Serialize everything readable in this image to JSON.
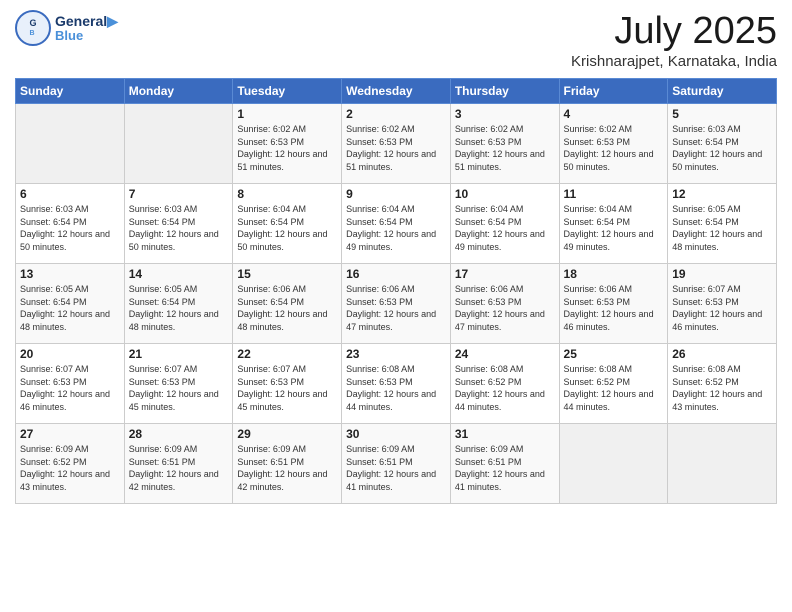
{
  "logo": {
    "line1": "General",
    "line2": "Blue"
  },
  "title": "July 2025",
  "subtitle": "Krishnarajpet, Karnataka, India",
  "days_of_week": [
    "Sunday",
    "Monday",
    "Tuesday",
    "Wednesday",
    "Thursday",
    "Friday",
    "Saturday"
  ],
  "weeks": [
    [
      {
        "day": "",
        "empty": true
      },
      {
        "day": "",
        "empty": true
      },
      {
        "day": "1",
        "sunrise": "6:02 AM",
        "sunset": "6:53 PM",
        "daylight": "12 hours and 51 minutes."
      },
      {
        "day": "2",
        "sunrise": "6:02 AM",
        "sunset": "6:53 PM",
        "daylight": "12 hours and 51 minutes."
      },
      {
        "day": "3",
        "sunrise": "6:02 AM",
        "sunset": "6:53 PM",
        "daylight": "12 hours and 51 minutes."
      },
      {
        "day": "4",
        "sunrise": "6:02 AM",
        "sunset": "6:53 PM",
        "daylight": "12 hours and 50 minutes."
      },
      {
        "day": "5",
        "sunrise": "6:03 AM",
        "sunset": "6:54 PM",
        "daylight": "12 hours and 50 minutes."
      }
    ],
    [
      {
        "day": "6",
        "sunrise": "6:03 AM",
        "sunset": "6:54 PM",
        "daylight": "12 hours and 50 minutes."
      },
      {
        "day": "7",
        "sunrise": "6:03 AM",
        "sunset": "6:54 PM",
        "daylight": "12 hours and 50 minutes."
      },
      {
        "day": "8",
        "sunrise": "6:04 AM",
        "sunset": "6:54 PM",
        "daylight": "12 hours and 50 minutes."
      },
      {
        "day": "9",
        "sunrise": "6:04 AM",
        "sunset": "6:54 PM",
        "daylight": "12 hours and 49 minutes."
      },
      {
        "day": "10",
        "sunrise": "6:04 AM",
        "sunset": "6:54 PM",
        "daylight": "12 hours and 49 minutes."
      },
      {
        "day": "11",
        "sunrise": "6:04 AM",
        "sunset": "6:54 PM",
        "daylight": "12 hours and 49 minutes."
      },
      {
        "day": "12",
        "sunrise": "6:05 AM",
        "sunset": "6:54 PM",
        "daylight": "12 hours and 48 minutes."
      }
    ],
    [
      {
        "day": "13",
        "sunrise": "6:05 AM",
        "sunset": "6:54 PM",
        "daylight": "12 hours and 48 minutes."
      },
      {
        "day": "14",
        "sunrise": "6:05 AM",
        "sunset": "6:54 PM",
        "daylight": "12 hours and 48 minutes."
      },
      {
        "day": "15",
        "sunrise": "6:06 AM",
        "sunset": "6:54 PM",
        "daylight": "12 hours and 48 minutes."
      },
      {
        "day": "16",
        "sunrise": "6:06 AM",
        "sunset": "6:53 PM",
        "daylight": "12 hours and 47 minutes."
      },
      {
        "day": "17",
        "sunrise": "6:06 AM",
        "sunset": "6:53 PM",
        "daylight": "12 hours and 47 minutes."
      },
      {
        "day": "18",
        "sunrise": "6:06 AM",
        "sunset": "6:53 PM",
        "daylight": "12 hours and 46 minutes."
      },
      {
        "day": "19",
        "sunrise": "6:07 AM",
        "sunset": "6:53 PM",
        "daylight": "12 hours and 46 minutes."
      }
    ],
    [
      {
        "day": "20",
        "sunrise": "6:07 AM",
        "sunset": "6:53 PM",
        "daylight": "12 hours and 46 minutes."
      },
      {
        "day": "21",
        "sunrise": "6:07 AM",
        "sunset": "6:53 PM",
        "daylight": "12 hours and 45 minutes."
      },
      {
        "day": "22",
        "sunrise": "6:07 AM",
        "sunset": "6:53 PM",
        "daylight": "12 hours and 45 minutes."
      },
      {
        "day": "23",
        "sunrise": "6:08 AM",
        "sunset": "6:53 PM",
        "daylight": "12 hours and 44 minutes."
      },
      {
        "day": "24",
        "sunrise": "6:08 AM",
        "sunset": "6:52 PM",
        "daylight": "12 hours and 44 minutes."
      },
      {
        "day": "25",
        "sunrise": "6:08 AM",
        "sunset": "6:52 PM",
        "daylight": "12 hours and 44 minutes."
      },
      {
        "day": "26",
        "sunrise": "6:08 AM",
        "sunset": "6:52 PM",
        "daylight": "12 hours and 43 minutes."
      }
    ],
    [
      {
        "day": "27",
        "sunrise": "6:09 AM",
        "sunset": "6:52 PM",
        "daylight": "12 hours and 43 minutes."
      },
      {
        "day": "28",
        "sunrise": "6:09 AM",
        "sunset": "6:51 PM",
        "daylight": "12 hours and 42 minutes."
      },
      {
        "day": "29",
        "sunrise": "6:09 AM",
        "sunset": "6:51 PM",
        "daylight": "12 hours and 42 minutes."
      },
      {
        "day": "30",
        "sunrise": "6:09 AM",
        "sunset": "6:51 PM",
        "daylight": "12 hours and 41 minutes."
      },
      {
        "day": "31",
        "sunrise": "6:09 AM",
        "sunset": "6:51 PM",
        "daylight": "12 hours and 41 minutes."
      },
      {
        "day": "",
        "empty": true
      },
      {
        "day": "",
        "empty": true
      }
    ]
  ]
}
